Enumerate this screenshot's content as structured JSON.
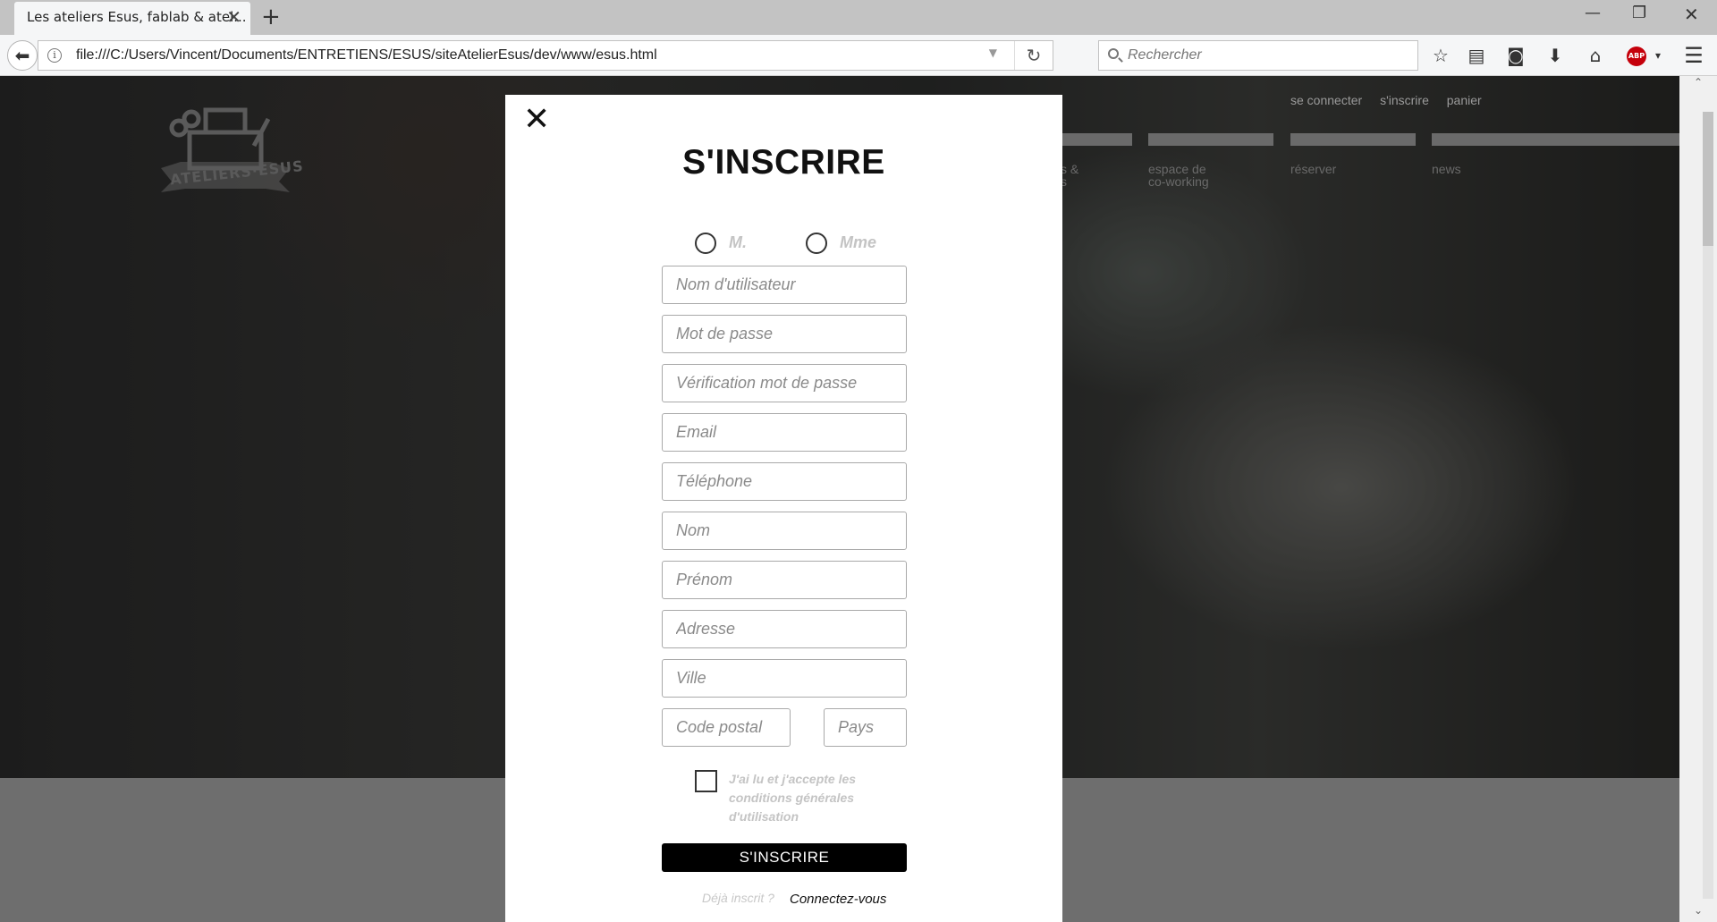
{
  "browser": {
    "tab_title": "Les ateliers Esus, fablab & atel...",
    "new_tab_symbol": "+",
    "url": "file:///C:/Users/Vincent/Documents/ENTRETIENS/ESUS/siteAtelierEsus/dev/www/esus.html",
    "search_placeholder": "Rechercher",
    "adblock_label": "ABP"
  },
  "site": {
    "logo_text": "ATELIERS·ESUS",
    "top_links": [
      "se connecter",
      "s'inscrire",
      "panier"
    ],
    "nav_items": [
      {
        "line1": "s &",
        "line2": "s"
      },
      {
        "line1": "espace de",
        "line2": "co-working"
      },
      {
        "line1": "réserver",
        "line2": ""
      },
      {
        "line1": "news",
        "line2": ""
      }
    ]
  },
  "modal": {
    "close_symbol": "✕",
    "title": "S'INSCRIRE",
    "civility": {
      "male": "M.",
      "female": "Mme"
    },
    "fields": {
      "username": "Nom d'utilisateur",
      "password": "Mot de passe",
      "password_confirm": "Vérification mot de passe",
      "email": "Email",
      "phone": "Téléphone",
      "lastname": "Nom",
      "firstname": "Prénom",
      "address": "Adresse",
      "city": "Ville",
      "zip": "Code postal",
      "country": "Pays"
    },
    "terms_text": "J'ai lu et j'accepte les conditions générales d'utilisation",
    "submit_label": "S'INSCRIRE",
    "already_registered": "Déjà inscrit ?",
    "login_link": "Connectez-vous"
  },
  "colors": {
    "modal_bg": "#ffffff",
    "button_bg": "#000000",
    "muted_label": "#c4c4c4",
    "footer_band": "#6e6e6e",
    "adblock_red": "#c5000b"
  }
}
